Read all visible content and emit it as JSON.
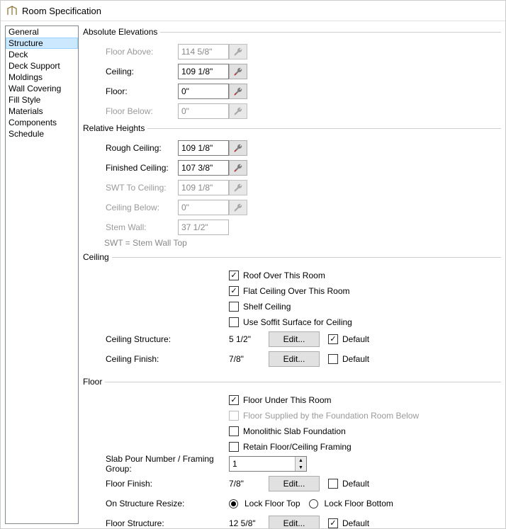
{
  "window": {
    "title": "Room Specification"
  },
  "sidebar": {
    "items": [
      {
        "label": "General"
      },
      {
        "label": "Structure"
      },
      {
        "label": "Deck"
      },
      {
        "label": "Deck Support"
      },
      {
        "label": "Moldings"
      },
      {
        "label": "Wall Covering"
      },
      {
        "label": "Fill Style"
      },
      {
        "label": "Materials"
      },
      {
        "label": "Components"
      },
      {
        "label": "Schedule"
      }
    ],
    "selected": 1
  },
  "absElev": {
    "group": "Absolute Elevations",
    "floorAbove": {
      "label": "Floor Above:",
      "value": "114 5/8\""
    },
    "ceiling": {
      "label": "Ceiling:",
      "value": "109 1/8\""
    },
    "floor": {
      "label": "Floor:",
      "value": "0\""
    },
    "floorBelow": {
      "label": "Floor Below:",
      "value": "0\""
    }
  },
  "relHeights": {
    "group": "Relative Heights",
    "roughCeiling": {
      "label": "Rough Ceiling:",
      "value": "109 1/8\""
    },
    "finishedCeiling": {
      "label": "Finished Ceiling:",
      "value": "107 3/8\""
    },
    "swtToCeiling": {
      "label": "SWT To Ceiling:",
      "value": "109 1/8\""
    },
    "ceilingBelow": {
      "label": "Ceiling Below:",
      "value": "0\""
    },
    "stemWall": {
      "label": "Stem Wall:",
      "value": "37 1/2\""
    },
    "note": "SWT = Stem Wall Top"
  },
  "ceiling": {
    "group": "Ceiling",
    "roofOver": {
      "label": "Roof Over This Room",
      "checked": true
    },
    "flatCeiling": {
      "label": "Flat Ceiling Over This Room",
      "checked": true
    },
    "shelfCeiling": {
      "label": "Shelf Ceiling",
      "checked": false
    },
    "useSoffit": {
      "label": "Use Soffit Surface for Ceiling",
      "checked": false
    },
    "ceilingStructure": {
      "label": "Ceiling Structure:",
      "value": "5 1/2\"",
      "edit": "Edit...",
      "default": true
    },
    "ceilingFinish": {
      "label": "Ceiling Finish:",
      "value": "7/8\"",
      "edit": "Edit...",
      "default": false
    }
  },
  "floor": {
    "group": "Floor",
    "floorUnder": {
      "label": "Floor Under This Room",
      "checked": true
    },
    "suppliedBy": {
      "label": "Floor Supplied by the Foundation Room Below",
      "checked": false,
      "disabled": true
    },
    "monolithic": {
      "label": "Monolithic Slab Foundation",
      "checked": false
    },
    "retain": {
      "label": "Retain Floor/Ceiling Framing",
      "checked": false
    },
    "slabPour": {
      "label": "Slab Pour Number / Framing Group:",
      "value": "1"
    },
    "floorFinish": {
      "label": "Floor Finish:",
      "value": "7/8\"",
      "edit": "Edit...",
      "default": false
    },
    "onResize": {
      "label": "On Structure Resize:",
      "opt1": "Lock Floor Top",
      "opt2": "Lock Floor Bottom",
      "selected": 0
    },
    "floorStructure": {
      "label": "Floor Structure:",
      "value": "12 5/8\"",
      "edit": "Edit...",
      "default": true
    }
  },
  "common": {
    "default": "Default"
  }
}
